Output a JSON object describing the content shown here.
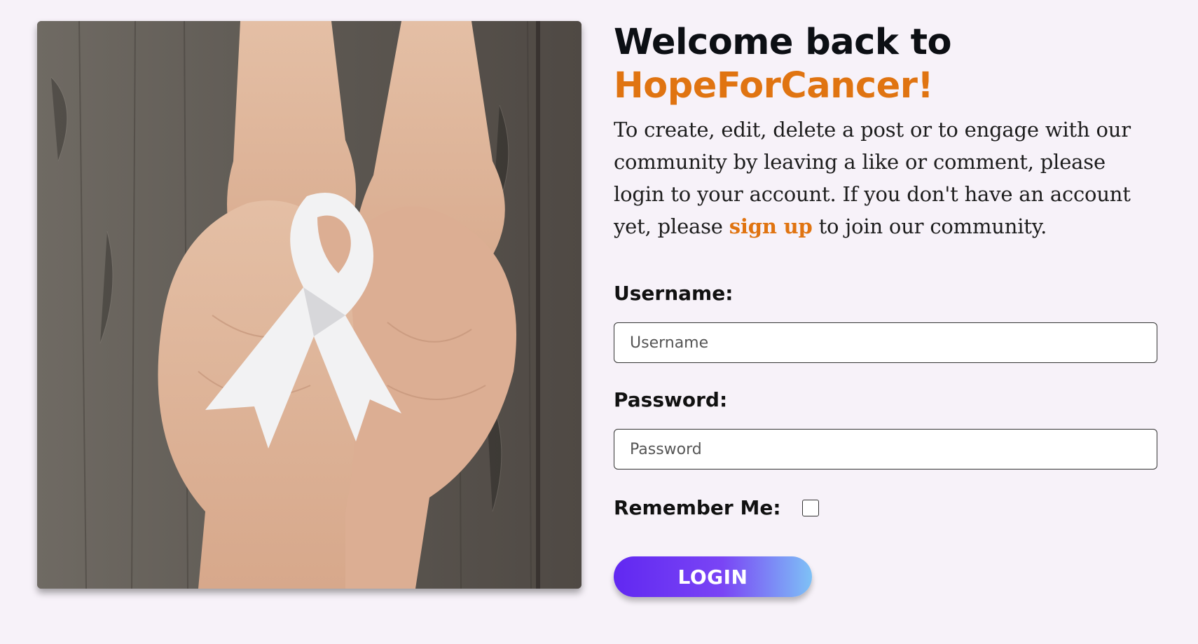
{
  "hero": {
    "image_name": "hands-holding-white-ribbon-photo"
  },
  "heading": {
    "line1": "Welcome back to",
    "line2": "HopeForCancer!"
  },
  "intro": {
    "before": "To create, edit, delete a post or to engage with our community by leaving a like or comment, please login to your account. If you don't have an account yet, please ",
    "link": "sign up",
    "after": " to join our community."
  },
  "form": {
    "username_label": "Username:",
    "username_placeholder": "Username",
    "username_value": "",
    "password_label": "Password:",
    "password_placeholder": "Password",
    "password_value": "",
    "remember_label": "Remember Me:",
    "remember_checked": false,
    "login_label": "LOGIN"
  },
  "colors": {
    "accent": "#e07411",
    "page_bg": "#f7f2f9",
    "button_start": "#6128f1",
    "button_end": "#7ec1f6"
  }
}
